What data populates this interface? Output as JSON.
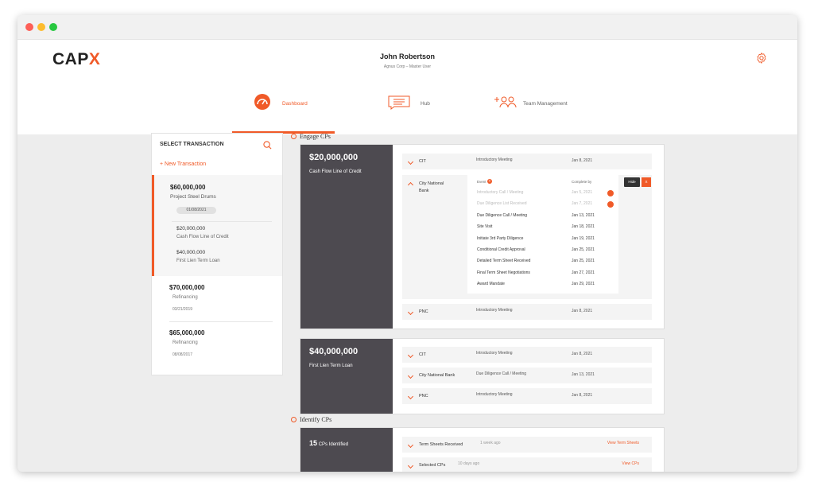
{
  "brand": {
    "logo_main": "CAP",
    "logo_accent": "X",
    "accent_color": "#f05a28"
  },
  "user": {
    "name": "John Robertson",
    "subtitle": "Agnus Corp – Master User"
  },
  "nav": {
    "dashboard": "Dashboard",
    "hub": "Hub",
    "team": "Team Management"
  },
  "transactions": {
    "heading": "SELECT TRANSACTION",
    "new_label": "+ New Transaction",
    "items": [
      {
        "amount": "$60,000,000",
        "name": "Project Steel Drums",
        "date": "01/08/2021",
        "subs": [
          {
            "amount": "$20,000,000",
            "name": "Cash Flow Line of Credit"
          },
          {
            "amount": "$40,000,000",
            "name": "First Lien Term Loan"
          }
        ]
      },
      {
        "amount": "$70,000,000",
        "name": "Refinancing",
        "date": "03/21/2019"
      },
      {
        "amount": "$65,000,000",
        "name": "Refinancing",
        "date": "08/08/2017"
      }
    ]
  },
  "engage": {
    "title": "Engage CPs",
    "card1": {
      "amount": "$20,000,000",
      "label": "Cash Flow Line of Credit",
      "rows": [
        {
          "name": "CIT",
          "event": "Introductory Meeting",
          "date": "Jan 8, 2021"
        },
        {
          "name": "PNC",
          "event": "Introductory Meeting",
          "date": "Jan 8, 2021"
        }
      ],
      "expanded": {
        "name": "City National Bank",
        "col_event": "Event",
        "col_complete": "Complete by",
        "hide_label": "Hide",
        "x_label": "X",
        "events": [
          {
            "event": "Introductory Call / Meeting",
            "date": "Jan 5, 2021",
            "done": true
          },
          {
            "event": "Due Diligence List Received",
            "date": "Jan 7, 2021",
            "done": true
          },
          {
            "event": "Due Diligence Call / Meeting",
            "date": "Jan 13, 2021",
            "done": false
          },
          {
            "event": "Site Visit",
            "date": "Jan 18, 2021",
            "done": false
          },
          {
            "event": "Initiate 3rd Party Diligence",
            "date": "Jan 19, 2021",
            "done": false
          },
          {
            "event": "Conditional Credit Approval",
            "date": "Jan 25, 2021",
            "done": false
          },
          {
            "event": "Detailed Term Sheet Received",
            "date": "Jan 25, 2021",
            "done": false
          },
          {
            "event": "Final Term Sheet Negotiations",
            "date": "Jan 27, 2021",
            "done": false
          },
          {
            "event": "Award Mandate",
            "date": "Jan 29, 2021",
            "done": false
          }
        ]
      }
    },
    "card2": {
      "amount": "$40,000,000",
      "label": "First Lien Term Loan",
      "rows": [
        {
          "name": "CIT",
          "event": "Introductory Meeting",
          "date": "Jan 8, 2021"
        },
        {
          "name": "City National Bank",
          "event": "Due Diligence Call / Meeting",
          "date": "Jan 13, 2021"
        },
        {
          "name": "PNC",
          "event": "Introductory Meeting",
          "date": "Jan 8, 2021"
        }
      ]
    }
  },
  "identify": {
    "title": "Identify CPs",
    "count": "15",
    "count_label": "CPs Identified",
    "rows": [
      {
        "name": "Term Sheets Received",
        "time": "1 week ago",
        "link": "View Term Sheets"
      },
      {
        "name": "Selected CPs",
        "time": "10 days ago",
        "link": "View CPs"
      }
    ]
  }
}
